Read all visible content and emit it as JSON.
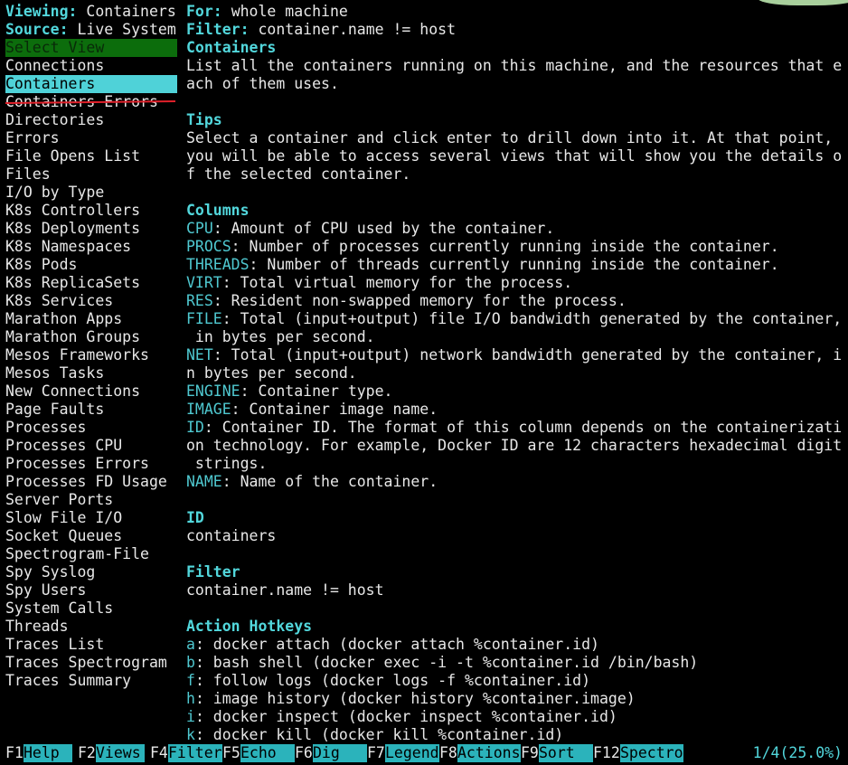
{
  "header": {
    "viewing_label": "Viewing:",
    "viewing_value": "Containers",
    "for_label": "For:",
    "for_value": "whole machine",
    "source_label": "Source:",
    "source_value": "Live System",
    "filter_label": "Filter:",
    "filter_value": "container.name != host"
  },
  "sidebar": {
    "title": "Select View",
    "selected": "Containers",
    "items": [
      "Connections",
      "Containers",
      "Containers Errors",
      "Directories",
      "Errors",
      "File Opens List",
      "Files",
      "I/O by Type",
      "K8s Controllers",
      "K8s Deployments",
      "K8s Namespaces",
      "K8s Pods",
      "K8s ReplicaSets",
      "K8s Services",
      "Marathon Apps",
      "Marathon Groups",
      "Mesos Frameworks",
      "Mesos Tasks",
      "New Connections",
      "Page Faults",
      "Processes",
      "Processes CPU",
      "Processes Errors",
      "Processes FD Usage",
      "Server Ports",
      "Slow File I/O",
      "Socket Queues",
      "Spectrogram-File",
      "Spy Syslog",
      "Spy Users",
      "System Calls",
      "Threads",
      "Traces List",
      "Traces Spectrogram",
      "Traces Summary"
    ]
  },
  "content": {
    "lines": [
      {
        "type": "section",
        "text": "Containers"
      },
      {
        "type": "text",
        "text": "List all the containers running on this machine, and the resources that e"
      },
      {
        "type": "text",
        "text": "ach of them uses."
      },
      {
        "type": "blank",
        "text": ""
      },
      {
        "type": "section",
        "text": "Tips"
      },
      {
        "type": "text",
        "text": "Select a container and click enter to drill down into it. At that point,"
      },
      {
        "type": "text",
        "text": "you will be able to access several views that will show you the details o"
      },
      {
        "type": "text",
        "text": "f the selected container."
      },
      {
        "type": "blank",
        "text": ""
      },
      {
        "type": "section",
        "text": "Columns"
      },
      {
        "type": "kv",
        "key": "CPU",
        "text": ": Amount of CPU used by the container."
      },
      {
        "type": "kv",
        "key": "PROCS",
        "text": ": Number of processes currently running inside the container."
      },
      {
        "type": "kv",
        "key": "THREADS",
        "text": ": Number of threads currently running inside the container."
      },
      {
        "type": "kv",
        "key": "VIRT",
        "text": ": Total virtual memory for the process."
      },
      {
        "type": "kv",
        "key": "RES",
        "text": ": Resident non-swapped memory for the process."
      },
      {
        "type": "kv",
        "key": "FILE",
        "text": ": Total (input+output) file I/O bandwidth generated by the container,"
      },
      {
        "type": "text",
        "text": " in bytes per second."
      },
      {
        "type": "kv",
        "key": "NET",
        "text": ": Total (input+output) network bandwidth generated by the container, i"
      },
      {
        "type": "text",
        "text": "n bytes per second."
      },
      {
        "type": "kv",
        "key": "ENGINE",
        "text": ": Container type."
      },
      {
        "type": "kv",
        "key": "IMAGE",
        "text": ": Container image name."
      },
      {
        "type": "kv",
        "key": "ID",
        "text": ": Container ID. The format of this column depends on the containerizati"
      },
      {
        "type": "text",
        "text": "on technology. For example, Docker ID are 12 characters hexadecimal digit"
      },
      {
        "type": "text",
        "text": " strings."
      },
      {
        "type": "kv",
        "key": "NAME",
        "text": ": Name of the container."
      },
      {
        "type": "blank",
        "text": ""
      },
      {
        "type": "section",
        "text": "ID"
      },
      {
        "type": "text",
        "text": "containers"
      },
      {
        "type": "blank",
        "text": ""
      },
      {
        "type": "section",
        "text": "Filter"
      },
      {
        "type": "text",
        "text": "container.name != host"
      },
      {
        "type": "blank",
        "text": ""
      },
      {
        "type": "section",
        "text": "Action Hotkeys"
      },
      {
        "type": "kv",
        "key": "a",
        "text": ": docker attach (docker attach %container.id)"
      },
      {
        "type": "kv",
        "key": "b",
        "text": ": bash shell (docker exec -i -t %container.id /bin/bash)"
      },
      {
        "type": "kv",
        "key": "f",
        "text": ": follow logs (docker logs -f %container.id)"
      },
      {
        "type": "kv",
        "key": "h",
        "text": ": image history (docker history %container.image)"
      },
      {
        "type": "kv",
        "key": "i",
        "text": ": docker inspect (docker inspect %container.id)"
      },
      {
        "type": "kv",
        "key": "k",
        "text": ": docker kill (docker kill %container.id)"
      }
    ]
  },
  "footer": {
    "keys": [
      {
        "key": "F1",
        "label": "Help  "
      },
      {
        "key": "F2",
        "label": "Views "
      },
      {
        "key": "F4",
        "label": "Filter"
      },
      {
        "key": "F5",
        "label": "Echo  "
      },
      {
        "key": "F6",
        "label": "Dig   "
      },
      {
        "key": "F7",
        "label": "Legend"
      },
      {
        "key": "F8",
        "label": "Actions"
      },
      {
        "key": "F9",
        "label": "Sort  "
      },
      {
        "key": "F12",
        "label": "Spectro"
      }
    ],
    "progress": "1/4(25.0%)"
  },
  "colors": {
    "accent_cyan": "#52d7dc",
    "selection": "#4fd2d8",
    "sidebar_title_bg": "#0c6d0c",
    "footer_label_bg": "#2bb3bb",
    "annotation_red": "#e0202a"
  }
}
